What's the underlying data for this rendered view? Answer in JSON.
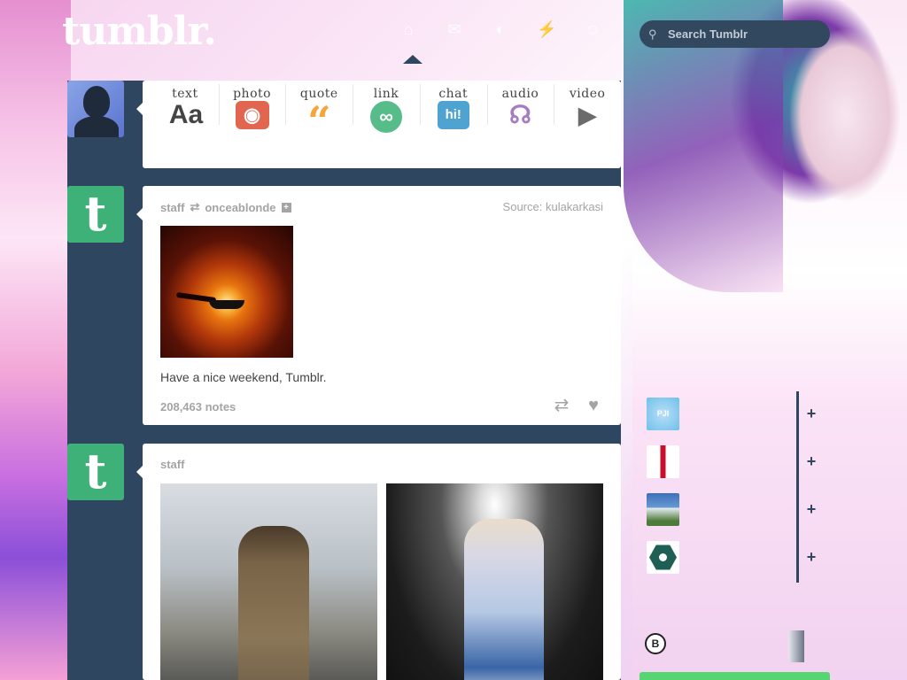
{
  "header": {
    "logo": "tumblr.",
    "nav_icons": [
      "home-icon",
      "explore-icon",
      "inbox-icon",
      "messages-icon",
      "account-icon"
    ],
    "search_placeholder": "Search Tumblr"
  },
  "post_types": [
    {
      "label": "text",
      "glyph": "Aa"
    },
    {
      "label": "photo",
      "glyph": "◉"
    },
    {
      "label": "quote",
      "glyph": "“"
    },
    {
      "label": "link",
      "glyph": "∞"
    },
    {
      "label": "chat",
      "glyph": "hi!"
    },
    {
      "label": "audio",
      "glyph": "☊"
    },
    {
      "label": "video",
      "glyph": "▶"
    }
  ],
  "posts": [
    {
      "author": "staff",
      "reblogged_from": "onceablonde",
      "source": "Source: kulakarkasi",
      "caption": "Have a nice weekend, Tumblr.",
      "notes": "208,463 notes"
    },
    {
      "author": "staff"
    }
  ],
  "recommendations": [
    {
      "avatar_text": "PJI",
      "follow_label": "+"
    },
    {
      "avatar_text": "",
      "follow_label": "+"
    },
    {
      "avatar_text": "",
      "follow_label": "+"
    },
    {
      "avatar_text": "",
      "follow_label": "+"
    }
  ],
  "badge": "B",
  "colors": {
    "dashboard_bg": "#2f4661",
    "tumblr_green": "#3eb178",
    "photo_red": "#e2654f",
    "quote_orange": "#f5a53a",
    "link_green": "#56bc8a",
    "chat_blue": "#4fa3d1",
    "audio_purple": "#a77dc2"
  }
}
